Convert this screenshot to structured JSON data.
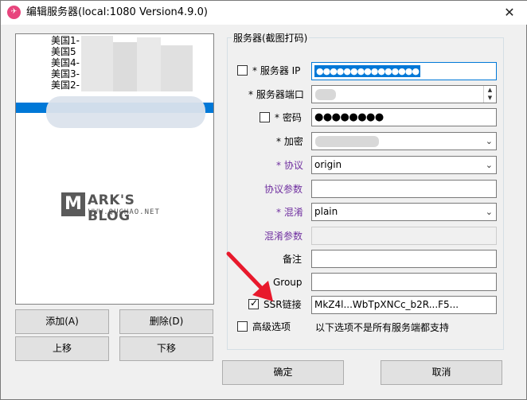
{
  "window": {
    "title": "编辑服务器(local:1080 Version4.9.0)",
    "app_icon_glyph": "✈",
    "close_glyph": "✕"
  },
  "server_list": {
    "items": [
      "美国1-",
      "美国5",
      "美国4-",
      "美国3-",
      "美国2-"
    ]
  },
  "watermark": {
    "logo_letter": "M",
    "title": "ARK'S BLOG",
    "subtitle": "WWW.QUCHAO.NET"
  },
  "buttons": {
    "add": "添加(A)",
    "delete": "删除(D)",
    "move_up": "上移",
    "move_down": "下移",
    "ok": "确定",
    "cancel": "取消"
  },
  "group": {
    "title": "服务器(截图打码)"
  },
  "form": {
    "server_ip_label": "* 服务器 IP",
    "server_ip_value": "●●●●●●●●●●●●●●●",
    "server_port_label": "* 服务器端口",
    "password_label": "* 密码",
    "password_value": "●●●●●●●●",
    "encryption_label": "* 加密",
    "protocol_label": "* 协议",
    "protocol_value": "origin",
    "protocol_param_label": "协议参数",
    "obfs_label": "* 混淆",
    "obfs_value": "plain",
    "obfs_param_label": "混淆参数",
    "remarks_label": "备注",
    "group_label": "Group",
    "ssr_link_label": "SSR链接",
    "ssr_link_value": "MkZ4l...WbTpXNCc_b2R...F5...",
    "advanced_label": "高级选项",
    "advanced_note": "以下选项不是所有服务端都支持"
  },
  "colors": {
    "accent": "#0078d7",
    "purple_label": "#7030a0",
    "arrow": "#e8192c"
  }
}
